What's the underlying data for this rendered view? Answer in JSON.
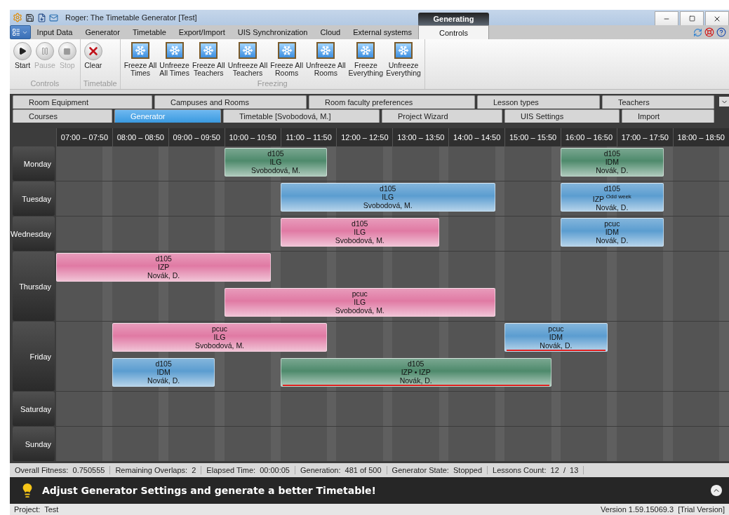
{
  "window": {
    "title": "Roger: The Timetable Generator [Test]",
    "contextual_group": "Generating"
  },
  "ribbon": {
    "tabs": [
      {
        "label": "Input Data",
        "selected": false
      },
      {
        "label": "Generator",
        "selected": false
      },
      {
        "label": "Timetable",
        "selected": false
      },
      {
        "label": "Export/Import",
        "selected": false
      },
      {
        "label": "UIS Synchronization",
        "selected": false
      },
      {
        "label": "Cloud",
        "selected": false
      },
      {
        "label": "External systems",
        "selected": false
      },
      {
        "label": "Controls",
        "selected": true
      }
    ],
    "groups": [
      {
        "caption": "Controls",
        "buttons": [
          {
            "kind": "start",
            "label": "Start",
            "disabled": false
          },
          {
            "kind": "pause",
            "label": "Pause",
            "disabled": true
          },
          {
            "kind": "stop",
            "label": "Stop",
            "disabled": true
          }
        ]
      },
      {
        "caption": "Timetable",
        "buttons": [
          {
            "kind": "clear",
            "label": "Clear",
            "disabled": false
          }
        ]
      },
      {
        "caption": "Freezing",
        "buttons": [
          {
            "kind": "freeze",
            "label": "Freeze All\nTimes",
            "disabled": false
          },
          {
            "kind": "freeze",
            "label": "Unfreeze\nAll Times",
            "disabled": false
          },
          {
            "kind": "freeze",
            "label": "Freeze All\nTeachers",
            "disabled": false
          },
          {
            "kind": "freeze",
            "label": "Unfreeze All\nTeachers",
            "disabled": false
          },
          {
            "kind": "freeze",
            "label": "Freeze All\nRooms",
            "disabled": false
          },
          {
            "kind": "freeze",
            "label": "Unfreeze All\nRooms",
            "disabled": false
          },
          {
            "kind": "freeze",
            "label": "Freeze\nEverything",
            "disabled": false
          },
          {
            "kind": "freeze",
            "label": "Unfreeze\nEverything",
            "disabled": false
          }
        ]
      }
    ]
  },
  "document_tabs": {
    "rows": [
      [
        {
          "label": "Room Equipment",
          "selected": false
        },
        {
          "label": "Campuses and Rooms",
          "selected": false
        },
        {
          "label": "Room faculty preferences",
          "selected": false
        },
        {
          "label": "Lesson types",
          "selected": false
        },
        {
          "label": "Teachers",
          "selected": false
        }
      ],
      [
        {
          "label": "Courses",
          "selected": false
        },
        {
          "label": "Generator",
          "selected": true
        },
        {
          "label": "Timetable [Svobodová, M.]",
          "selected": false
        },
        {
          "label": "Project Wizard",
          "selected": false
        },
        {
          "label": "UIS Settings",
          "selected": false
        },
        {
          "label": "Import",
          "selected": false
        }
      ]
    ]
  },
  "timetable": {
    "hours": [
      "07:00 – 07:50",
      "08:00 – 08:50",
      "09:00 – 09:50",
      "10:00 – 10:50",
      "11:00 – 11:50",
      "12:00 – 12:50",
      "13:00 – 13:50",
      "14:00 – 14:50",
      "15:00 – 15:50",
      "16:00 – 16:50",
      "17:00 – 17:50",
      "18:00 – 18:50"
    ],
    "days": [
      {
        "name": "Monday",
        "lanes": [
          {
            "lessons": [
              {
                "room": "d105",
                "course": "ILG",
                "teacher": "Svobodová, M.",
                "color": "#4e8a6c",
                "conflict": false
              },
              {
                "room": "d105",
                "course": "IDM",
                "teacher": "Novák, D.",
                "color": "#4e8a6c",
                "conflict": false
              }
            ]
          }
        ]
      },
      {
        "name": "Tuesday",
        "lanes": [
          {
            "lessons": [
              {
                "room": "d105",
                "course": "ILG",
                "teacher": "Svobodová, M.",
                "color": "#5b9dd0",
                "conflict": false
              },
              {
                "room": "d105",
                "course": "IZP $^{Odd week}$",
                "teacher": "Novák, D.",
                "color": "#5b9dd0",
                "conflict": false
              }
            ]
          }
        ]
      },
      {
        "name": "Wednesday",
        "lanes": [
          {
            "lessons": [
              {
                "room": "d105",
                "course": "ILG",
                "teacher": "Svobodová, M.",
                "color": "#e07aa4",
                "conflict": false
              },
              {
                "room": "pcuc",
                "course": "IDM",
                "teacher": "Novák, D.",
                "color": "#5b9dd0",
                "conflict": false
              }
            ]
          }
        ]
      },
      {
        "name": "Thursday",
        "lanes": [
          {
            "lessons": [
              {
                "room": "d105",
                "course": "IZP",
                "teacher": "Novák, D.",
                "color": "#e07aa4",
                "conflict": false
              }
            ]
          },
          {
            "lessons": [
              {
                "room": "pcuc",
                "course": "ILG",
                "teacher": "Svobodová, M.",
                "color": "#e07aa4",
                "conflict": false
              }
            ]
          }
        ]
      },
      {
        "name": "Friday",
        "lanes": [
          {
            "lessons": [
              {
                "room": "pcuc",
                "course": "ILG",
                "teacher": "Svobodová, M.",
                "color": "#e07aa4",
                "conflict": false
              },
              {
                "room": "pcuc",
                "course": "IDM",
                "teacher": "Novák, D.",
                "color": "#5b9dd0",
                "conflict": true
              }
            ]
          },
          {
            "lessons": [
              {
                "room": "d105",
                "course": "IDM",
                "teacher": "Novák, D.",
                "color": "#5b9dd0",
                "conflict": false
              },
              {
                "room": "d105",
                "course": "IZP • IZP",
                "teacher": "Novák, D.",
                "color": "#4e8a6c",
                "conflict": true
              }
            ]
          }
        ]
      },
      {
        "name": "Saturday"
      },
      {
        "name": "Sunday"
      }
    ]
  },
  "status_bar": [
    "Overall Fitness:  0.750555",
    "Remaining Overlaps:  2",
    "Elapsed Time:  00:00:05",
    "Generation:  481 of 500",
    "Generator State:  Stopped",
    "Lessons Count:  12  /  13"
  ],
  "message": "Adjust Generator Settings and generate a better Timetable!",
  "footer": {
    "project": "Project:  Test",
    "version": "Version 1.59.15069.3  [Trial Version]"
  }
}
